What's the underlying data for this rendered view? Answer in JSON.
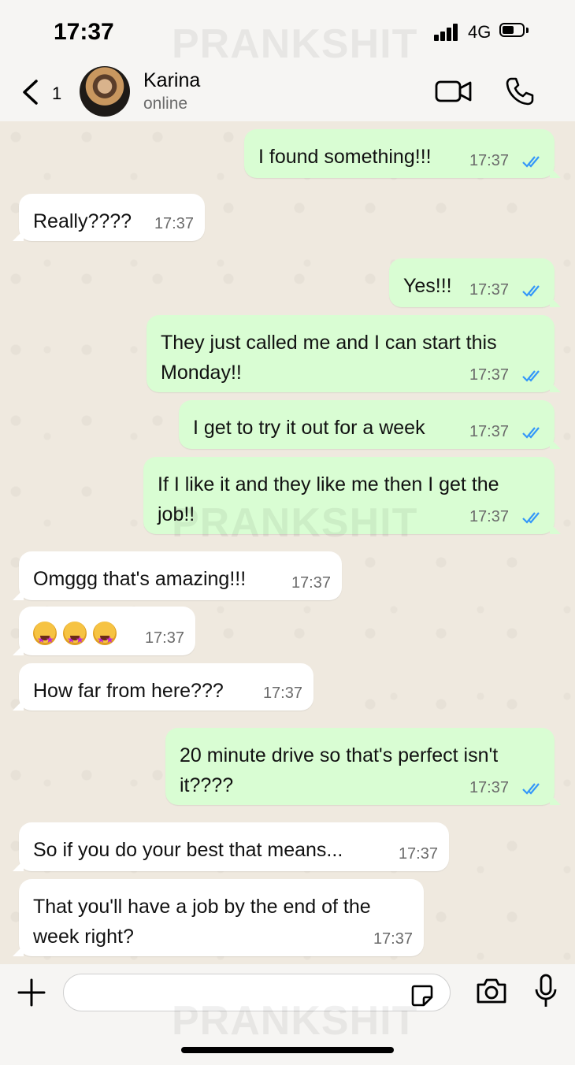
{
  "status_bar": {
    "time": "17:37",
    "network": "4G"
  },
  "watermark": "PRANKSHIT",
  "header": {
    "unread_count": "1",
    "contact_name": "Karina",
    "contact_status": "online"
  },
  "messages": [
    {
      "direction": "out",
      "lines": [
        "I found something!!!"
      ],
      "time": "17:37",
      "read": true
    },
    {
      "direction": "in",
      "lines": [
        "Really????"
      ],
      "time": "17:37"
    },
    {
      "direction": "out",
      "lines": [
        "Yes!!!"
      ],
      "time": "17:37",
      "read": true
    },
    {
      "direction": "out",
      "lines": [
        "They just called me and I can start this",
        "Monday!!"
      ],
      "time": "17:37",
      "read": true
    },
    {
      "direction": "out",
      "lines": [
        "I get to try it out for a week"
      ],
      "time": "17:37",
      "read": true
    },
    {
      "direction": "out",
      "lines": [
        "If I like it and they like me then I get the",
        "job!!"
      ],
      "time": "17:37",
      "read": true
    },
    {
      "direction": "in",
      "lines": [
        "Omggg that's amazing!!!"
      ],
      "time": "17:37"
    },
    {
      "direction": "in",
      "emoji": [
        "star-struck-emoji",
        "star-struck-emoji",
        "star-struck-emoji"
      ],
      "time": "17:37"
    },
    {
      "direction": "in",
      "lines": [
        "How far from here???"
      ],
      "time": "17:37"
    },
    {
      "direction": "out",
      "lines": [
        "20 minute drive so that's perfect isn't",
        "it????"
      ],
      "time": "17:37",
      "read": true
    },
    {
      "direction": "in",
      "lines": [
        "So if you do your best that means..."
      ],
      "time": "17:37"
    },
    {
      "direction": "in",
      "lines": [
        "That you'll have a job by the end of the",
        "week right?"
      ],
      "time": "17:37"
    }
  ],
  "input": {
    "placeholder": ""
  },
  "colors": {
    "outgoing_bubble": "#d9fdd3",
    "incoming_bubble": "#ffffff",
    "read_ticks": "#3497f9",
    "chat_background": "#efe9df"
  }
}
